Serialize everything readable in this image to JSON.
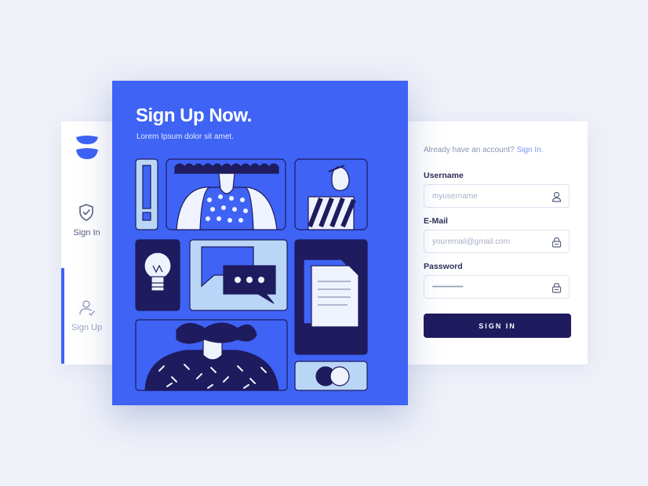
{
  "sidebar": {
    "items": [
      {
        "label": "Sign In",
        "icon": "shield-check-icon"
      },
      {
        "label": "Sign Up",
        "icon": "user-add-icon"
      }
    ],
    "active_index": 1
  },
  "hero": {
    "title": "Sign Up Now.",
    "subtitle": "Lorem Ipsum dolor sit amet."
  },
  "form": {
    "already_text": "Already have an account?",
    "signin_link": "Sign In.",
    "username": {
      "label": "Username",
      "placeholder": "myusername",
      "icon": "user-icon"
    },
    "email": {
      "label": "E-Mail",
      "placeholder": "youremail@gmail.com",
      "icon": "lock-icon"
    },
    "password": {
      "label": "Password",
      "value": "••••••••••••••••••••",
      "icon": "lock-icon"
    },
    "submit_label": "SIGN IN"
  },
  "colors": {
    "accent": "#3e63f5",
    "navy": "#1e1b5e",
    "light_blue": "#b9d6f7",
    "background": "#eef1f8"
  }
}
